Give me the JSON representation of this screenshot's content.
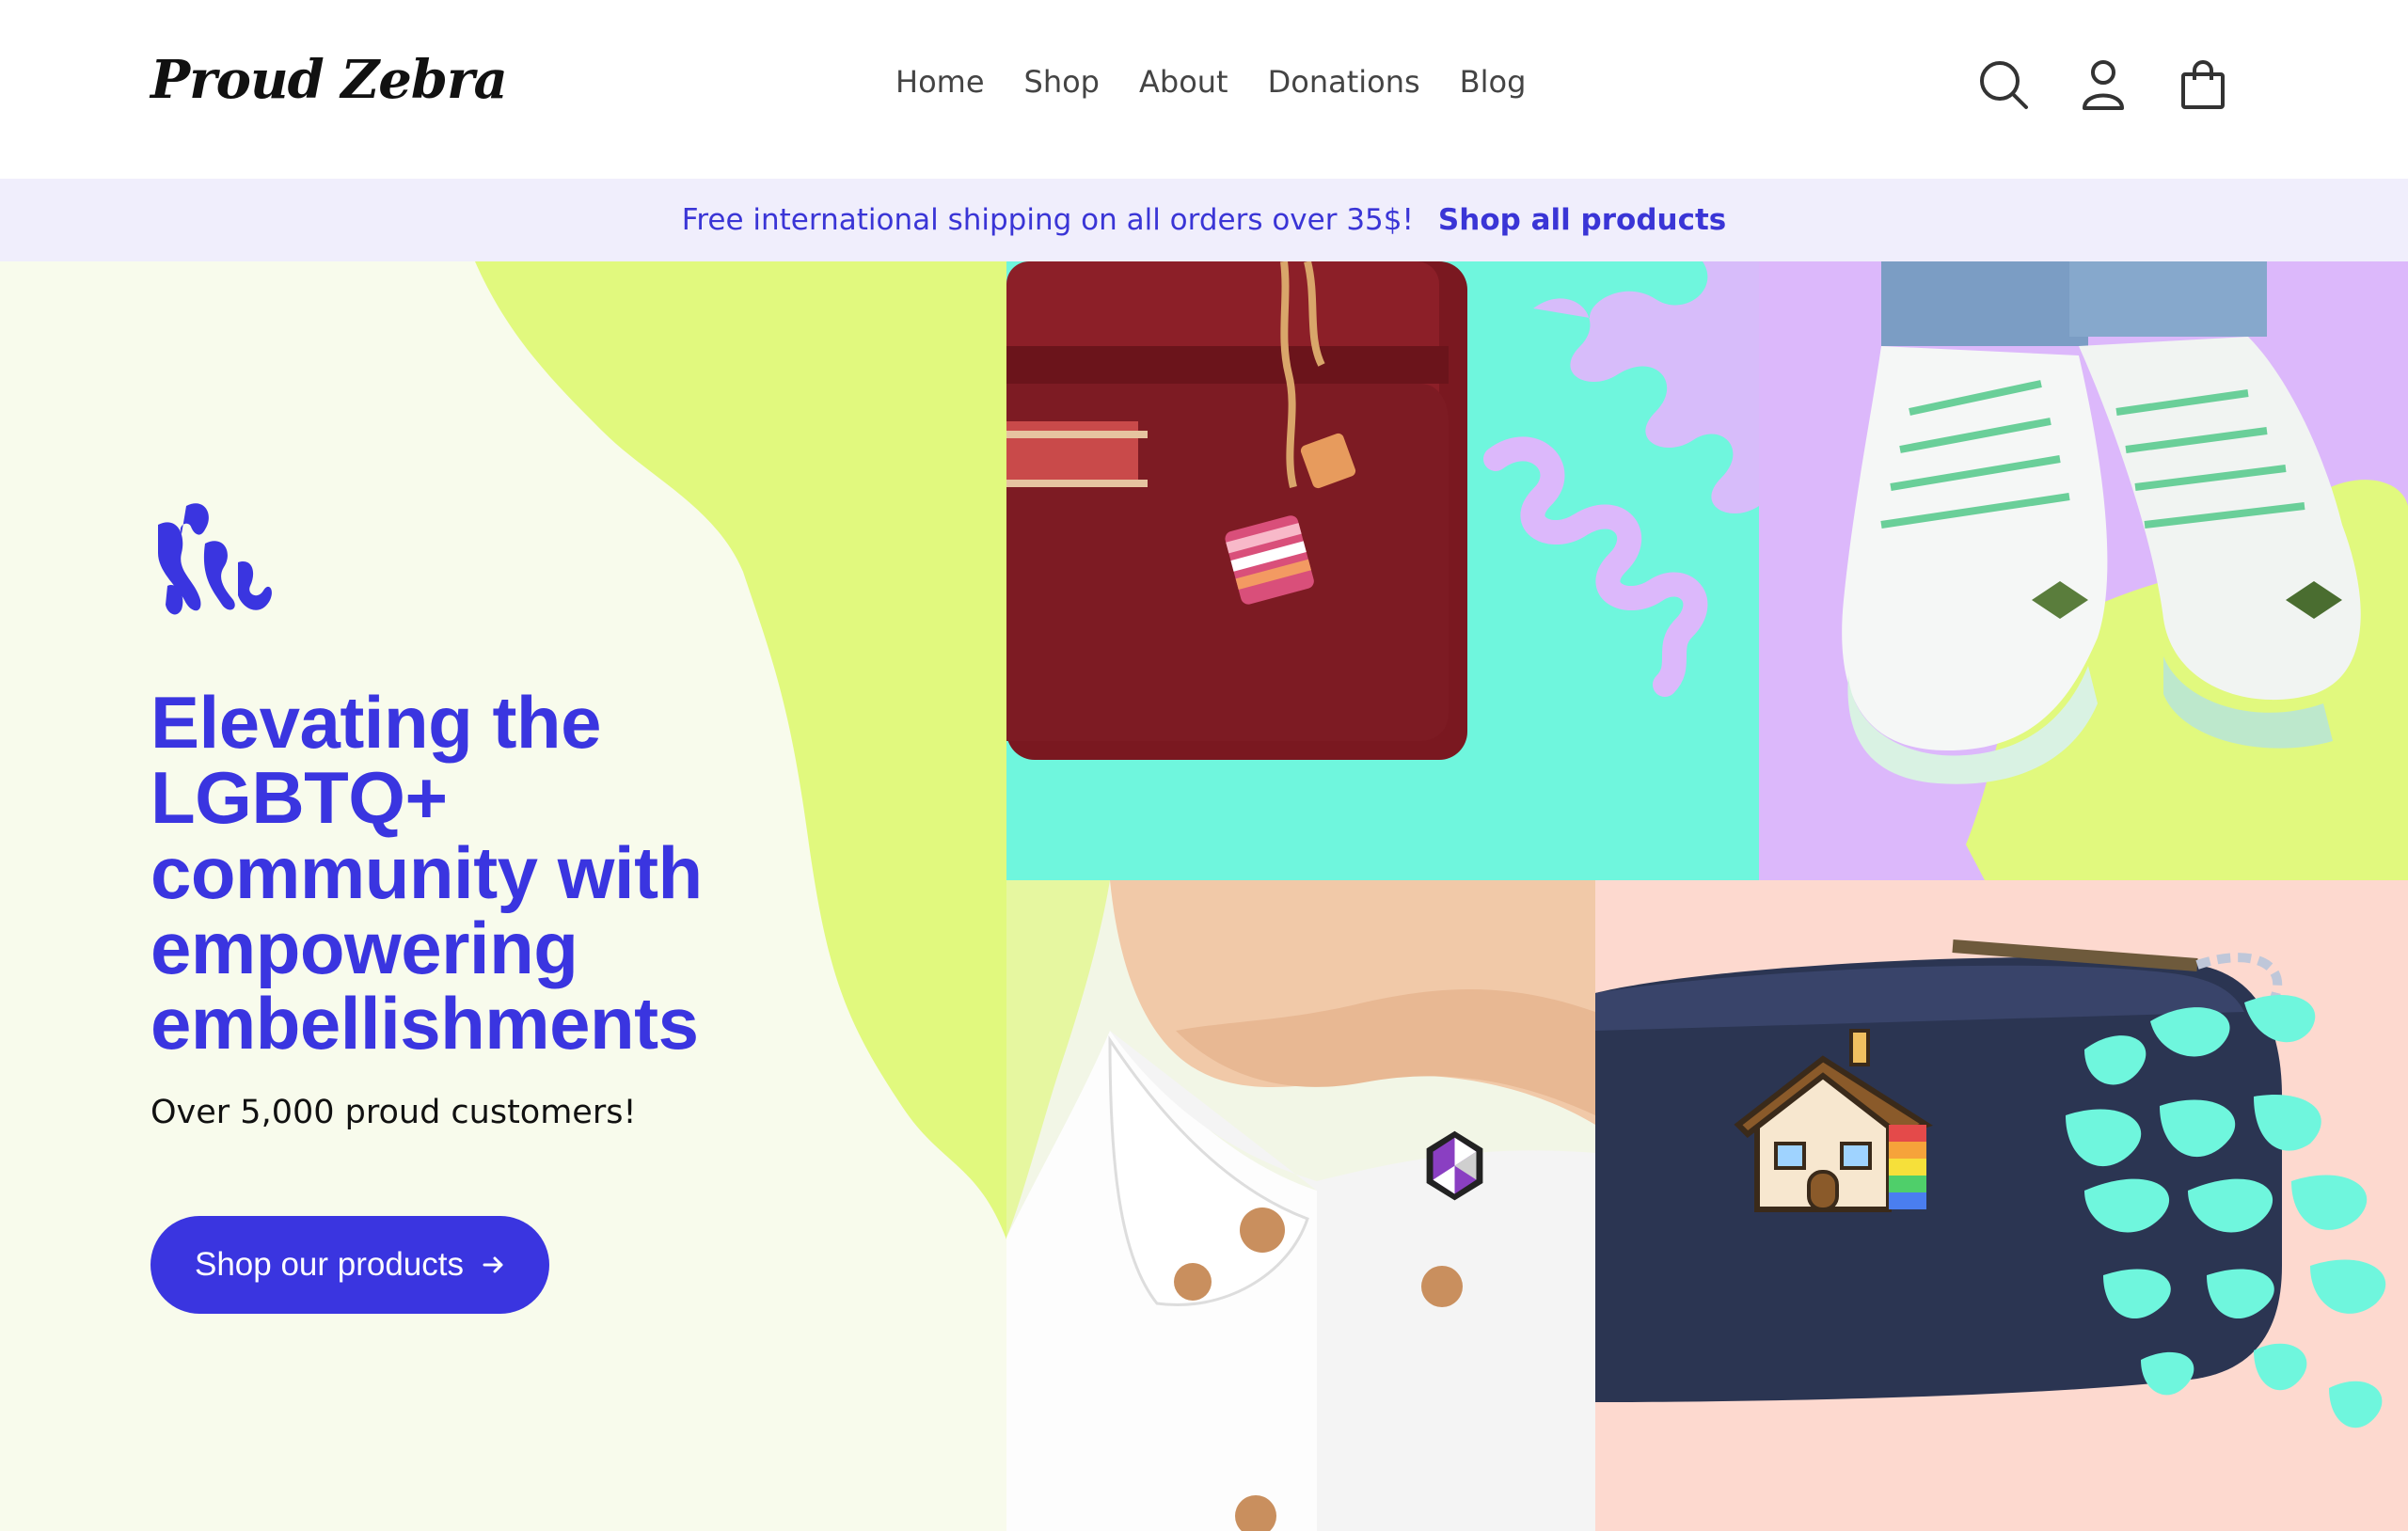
{
  "header": {
    "logo": "Proud Zebra",
    "nav": [
      "Home",
      "Shop",
      "About",
      "Donations",
      "Blog"
    ],
    "icons": [
      "search-icon",
      "account-icon",
      "cart-icon"
    ]
  },
  "announcement": {
    "message": "Free international shipping on all orders over 35$!",
    "link": "Shop all products"
  },
  "hero": {
    "headline": "Elevating the LGBTQ+ community with empowering embellishments",
    "subline": "Over 5,000 proud customers!",
    "cta_label": "Shop our products",
    "cta_icon": "arrow-right-icon"
  },
  "colors": {
    "brand": "#3a35e0",
    "announce_bg": "#f0eefc",
    "lime": "#e1f97e",
    "mint": "#6ff6dd",
    "lavender": "#dcb8fb",
    "peach": "#fdd9cf"
  }
}
